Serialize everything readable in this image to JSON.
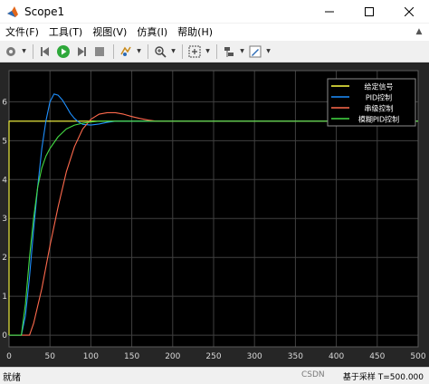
{
  "window": {
    "title": "Scope1",
    "minimize_icon": "minimize-icon",
    "maximize_icon": "maximize-icon",
    "close_icon": "close-icon"
  },
  "menu": {
    "items": [
      {
        "label": "文件(F)"
      },
      {
        "label": "工具(T)"
      },
      {
        "label": "视图(V)"
      },
      {
        "label": "仿真(I)"
      },
      {
        "label": "帮助(H)"
      }
    ]
  },
  "toolbar": {
    "icons": [
      "settings-gear-icon",
      "step-back-icon",
      "run-icon",
      "step-forward-icon",
      "stop-icon",
      "highlight-icon",
      "zoom-icon",
      "autoscale-icon",
      "cursor-measure-icon",
      "edit-icon"
    ]
  },
  "colors": {
    "background": "#000000",
    "axes_face": "#000000",
    "grid": "#404040",
    "tick_text": "#d9d9d9",
    "legend_bg": "#000000",
    "legend_border": "#8c8c8c"
  },
  "chart_data": {
    "type": "line",
    "xlim": [
      0,
      500
    ],
    "ylim": [
      -0.3,
      6.8
    ],
    "xticks": [
      0,
      50,
      100,
      150,
      200,
      250,
      300,
      350,
      400,
      450,
      500
    ],
    "yticks": [
      0,
      1,
      2,
      3,
      4,
      5,
      6
    ],
    "grid": true,
    "legend_position": "top-right",
    "series": [
      {
        "name": "给定信号",
        "color": "#ffff44",
        "x": [
          0,
          0,
          500
        ],
        "y": [
          0,
          5.5,
          5.5
        ]
      },
      {
        "name": "PID控制",
        "color": "#1e90ff",
        "x": [
          0,
          15,
          20,
          25,
          30,
          35,
          40,
          45,
          50,
          55,
          60,
          65,
          70,
          75,
          80,
          85,
          90,
          100,
          110,
          120,
          130,
          150,
          500
        ],
        "y": [
          0,
          0,
          0.5,
          1.5,
          2.7,
          3.8,
          4.8,
          5.5,
          6.0,
          6.2,
          6.17,
          6.05,
          5.88,
          5.7,
          5.57,
          5.48,
          5.42,
          5.4,
          5.43,
          5.47,
          5.5,
          5.5,
          5.5
        ]
      },
      {
        "name": "串级控制",
        "color": "#ff6a4d",
        "x": [
          0,
          25,
          30,
          40,
          50,
          60,
          70,
          80,
          90,
          100,
          110,
          120,
          130,
          140,
          150,
          160,
          170,
          180,
          200,
          220,
          500
        ],
        "y": [
          0,
          0,
          0.3,
          1.2,
          2.3,
          3.3,
          4.2,
          4.85,
          5.3,
          5.55,
          5.68,
          5.72,
          5.72,
          5.68,
          5.62,
          5.57,
          5.53,
          5.5,
          5.5,
          5.5,
          5.5
        ]
      },
      {
        "name": "模糊PID控制",
        "color": "#44dd44",
        "x": [
          0,
          15,
          20,
          25,
          30,
          35,
          40,
          45,
          50,
          60,
          70,
          80,
          90,
          100,
          110,
          120,
          140,
          160,
          500
        ],
        "y": [
          0,
          0,
          0.8,
          2.0,
          3.0,
          3.8,
          4.3,
          4.6,
          4.8,
          5.1,
          5.3,
          5.4,
          5.45,
          5.48,
          5.5,
          5.5,
          5.5,
          5.5,
          5.5
        ]
      }
    ]
  },
  "status": {
    "left": "就绪",
    "watermark": "CSDN",
    "right": "基于采样  T=500.000"
  }
}
